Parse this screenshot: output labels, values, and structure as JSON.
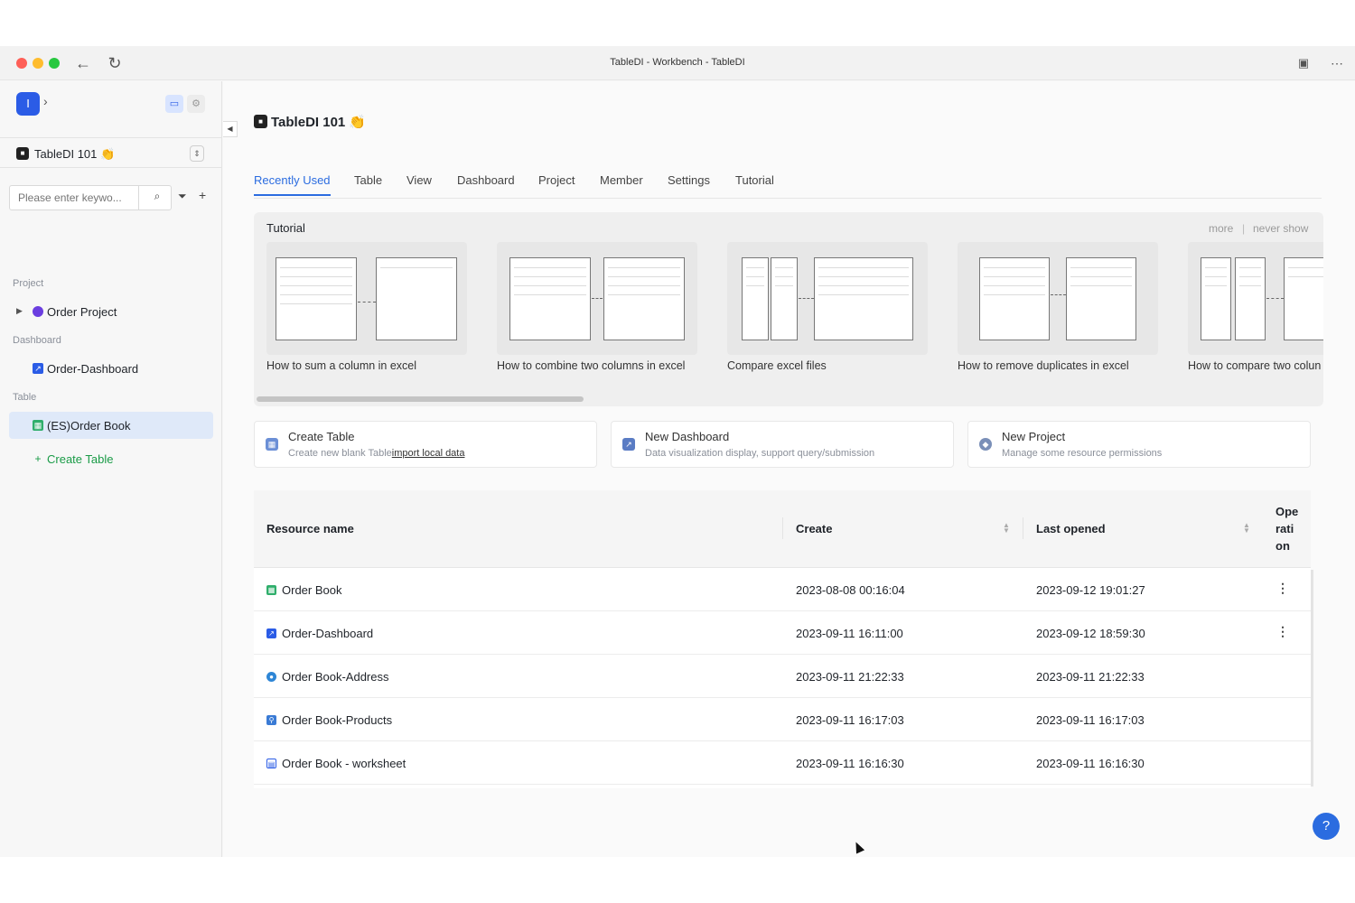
{
  "window": {
    "title": "TableDI - Workbench - TableDI"
  },
  "sidebar": {
    "logo": "I",
    "workspace": "TableDI 101 👏",
    "search_placeholder": "Please enter keywo...",
    "sections": {
      "project": "Project",
      "dashboard": "Dashboard",
      "table": "Table"
    },
    "items": {
      "project": "Order Project",
      "dashboard": "Order-Dashboard",
      "table": "(ES)Order Book",
      "create_table": "Create Table"
    }
  },
  "main": {
    "title": "TableDI 101 👏",
    "tabs": [
      "Recently Used",
      "Table",
      "View",
      "Dashboard",
      "Project",
      "Member",
      "Settings",
      "Tutorial"
    ],
    "active_tab": "Recently Used",
    "tutorial": {
      "title": "Tutorial",
      "more": "more",
      "never_show": "never show",
      "cards": [
        "How to sum a column in excel",
        "How to combine two columns in excel",
        "Compare excel files",
        "How to remove duplicates in excel",
        "How to compare two colun"
      ]
    },
    "quick_actions": {
      "create_table": {
        "title": "Create Table",
        "desc": "Create new blank Table",
        "link": "import local data"
      },
      "new_dashboard": {
        "title": "New Dashboard",
        "desc": "Data visualization display, support query/submission"
      },
      "new_project": {
        "title": "New Project",
        "desc": "Manage some resource permissions"
      }
    },
    "table": {
      "headers": {
        "name": "Resource name",
        "create": "Create",
        "opened": "Last opened",
        "op1": "Ope",
        "op2": "rati",
        "op3": "on"
      },
      "rows": [
        {
          "name": "Order Book",
          "create": "2023-08-08 00:16:04",
          "opened": "2023-09-12 19:01:27",
          "icon": "table-icon",
          "op": "⋮"
        },
        {
          "name": "Order-Dashboard",
          "create": "2023-09-11 16:11:00",
          "opened": "2023-09-12 18:59:30",
          "icon": "dashboard-icon",
          "op": "⋮"
        },
        {
          "name": "Order Book-Address",
          "create": "2023-09-11 21:22:33",
          "opened": "2023-09-11 21:22:33",
          "icon": "location-icon",
          "op": ""
        },
        {
          "name": "Order Book-Products",
          "create": "2023-09-11 16:17:03",
          "opened": "2023-09-11 16:17:03",
          "icon": "tree-icon",
          "op": ""
        },
        {
          "name": "Order Book - worksheet",
          "create": "2023-09-11 16:16:30",
          "opened": "2023-09-11 16:16:30",
          "icon": "worksheet-icon",
          "op": ""
        }
      ]
    },
    "help": "?"
  },
  "colors": {
    "accent": "#2b6ce0",
    "create_green": "#1a9b47",
    "brand": "#2b5ce6"
  }
}
